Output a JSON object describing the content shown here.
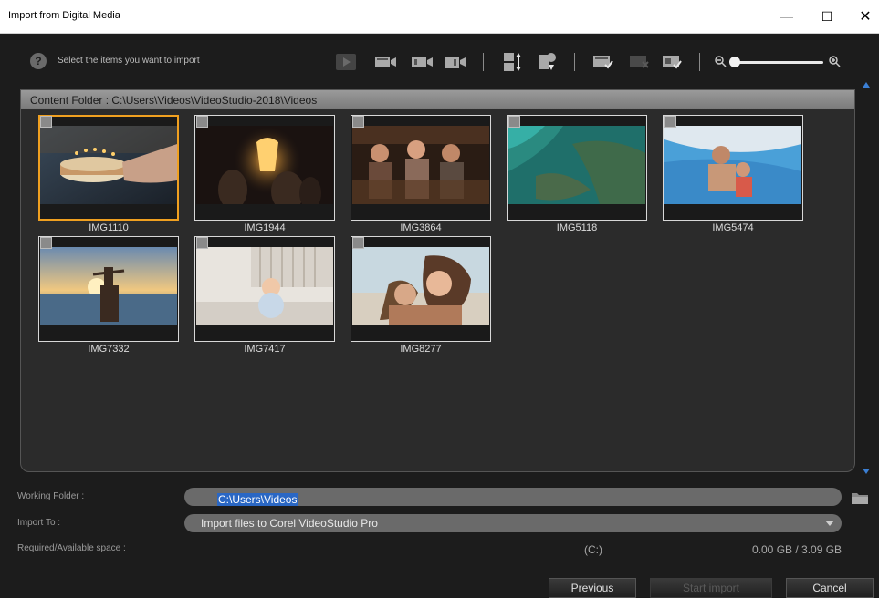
{
  "window": {
    "title": "Import from Digital Media",
    "minimize_glyph": "—",
    "maximize_glyph": "☐",
    "close_glyph": "✕"
  },
  "toolbar": {
    "help_glyph": "?",
    "help_text": "Select the items you want to import",
    "icons": [
      "play-icon",
      "mark-scene-icon",
      "set-in-icon",
      "set-out-icon",
      "sort-by-name-icon",
      "sort-by-date-icon",
      "select-all-icon",
      "deselect-all-icon",
      "invert-selection-icon"
    ],
    "zoom_level": 0
  },
  "content": {
    "folder_label": "Content Folder : C:\\Users\\Videos\\VideoStudio-2018\\Videos",
    "items": [
      {
        "label": "IMG1110",
        "selected": true
      },
      {
        "label": "IMG1944",
        "selected": false
      },
      {
        "label": "IMG3864",
        "selected": false
      },
      {
        "label": "IMG5118",
        "selected": false
      },
      {
        "label": "IMG5474",
        "selected": false
      },
      {
        "label": "IMG7332",
        "selected": false
      },
      {
        "label": "IMG7417",
        "selected": false
      },
      {
        "label": "IMG8277",
        "selected": false
      }
    ]
  },
  "settings": {
    "working_folder_label": "Working Folder :",
    "working_folder_value": "C:\\Users\\Videos",
    "import_to_label": "Import To :",
    "import_to_value": "Import files to Corel VideoStudio Pro",
    "space_label": "Required/Available space :",
    "space_drive": "(C:)",
    "space_value": "0.00 GB / 3.09 GB"
  },
  "buttons": {
    "previous": "Previous",
    "start_import": "Start import",
    "cancel": "Cancel"
  }
}
